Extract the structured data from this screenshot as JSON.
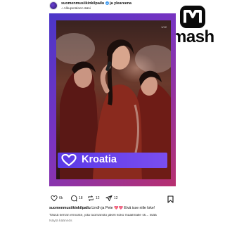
{
  "header": {
    "username": "suomenmusiikinkilpailu",
    "collab_joiner": "ja",
    "collab_account": "yleareena",
    "subtitle": "Alkuperäinen ääni"
  },
  "watermark": {
    "brand": "mash"
  },
  "post": {
    "slide_counter": "1/12",
    "country_label": "Kroatia",
    "colors": {
      "frame_gradient_start": "#4a36c8",
      "frame_gradient_end": "#b8306f",
      "label_bar": "#5b3ae6"
    }
  },
  "actions": {
    "likes": "6k",
    "comments": "18",
    "reposts": "12",
    "shares": "12"
  },
  "caption": {
    "author": "suomenmusiikinkilpailu",
    "text": "Lindh ja Pete 💖💖 Eivä isse niile loke!",
    "body": "Tässä kerran ennuste, jota tuomaristo jakeli koko maailmalle sk... lisää",
    "translation_link": "Näytä käännös"
  }
}
